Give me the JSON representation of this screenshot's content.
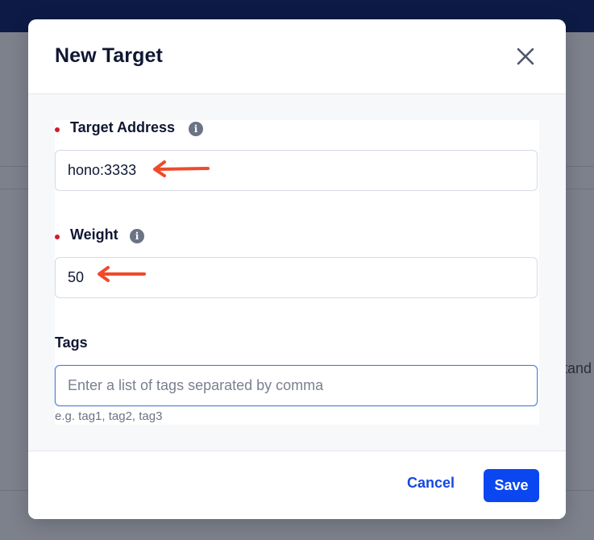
{
  "background": {
    "fragment_text": "tand"
  },
  "modal": {
    "title": "New Target",
    "fields": {
      "target_address": {
        "label": "Target Address",
        "required": true,
        "value": "hono:3333"
      },
      "weight": {
        "label": "Weight",
        "required": true,
        "value": "50"
      },
      "tags": {
        "label": "Tags",
        "value": "",
        "placeholder": "Enter a list of tags separated by comma",
        "hint": "e.g. tag1, tag2, tag3"
      }
    },
    "footer": {
      "cancel_label": "Cancel",
      "save_label": "Save"
    }
  },
  "colors": {
    "primary": "#0a47f0",
    "annotation_arrow": "#f04a2a",
    "required_dot": "#d11a2a"
  }
}
